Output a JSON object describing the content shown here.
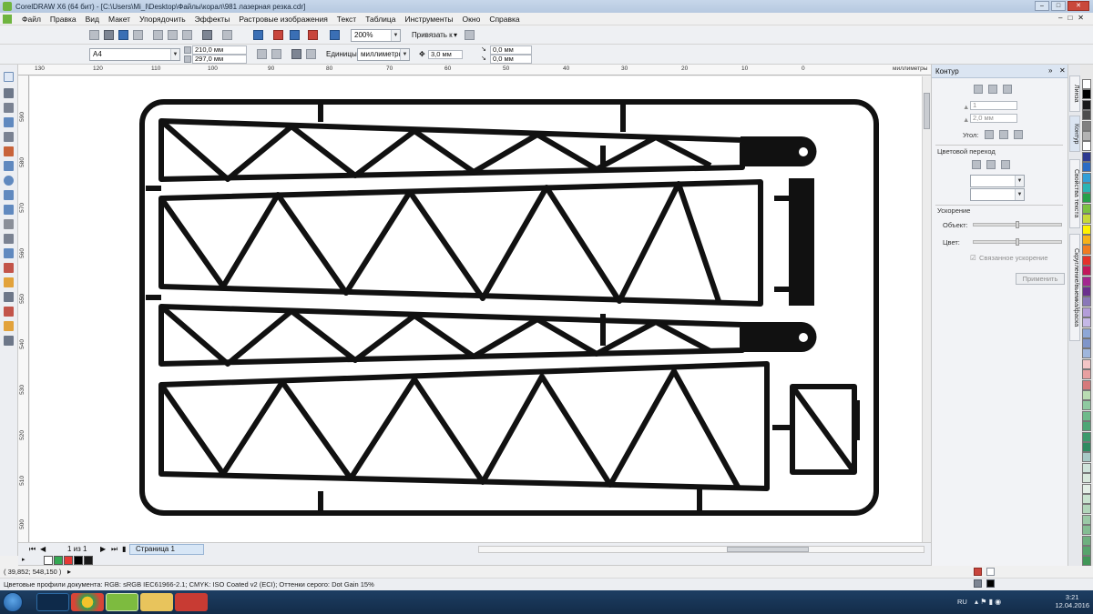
{
  "window": {
    "title": "CorelDRAW X6 (64 бит) - [C:\\Users\\Mi_I\\Desktop\\Файлы\\корал\\981 лазерная резка.cdr]"
  },
  "menu": [
    "Файл",
    "Правка",
    "Вид",
    "Макет",
    "Упорядочить",
    "Эффекты",
    "Растровые изображения",
    "Текст",
    "Таблица",
    "Инструменты",
    "Окно",
    "Справка"
  ],
  "toolbar": {
    "zoom": "200%",
    "snap_label": "Привязать к"
  },
  "propbar": {
    "page_size": "A4",
    "width": "210,0 мм",
    "height": "297,0 мм",
    "units_label": "Единицы:",
    "units_value": "миллиметры",
    "nudge": "3,0 мм",
    "dup_x": "0,0 мм",
    "dup_y": "0,0 мм"
  },
  "rulers": {
    "h_ticks": [
      "130",
      "120",
      "110",
      "100",
      "90",
      "80",
      "70",
      "60",
      "50",
      "40",
      "30",
      "20",
      "10",
      "0"
    ],
    "h_unit": "миллиметры",
    "v_ticks": [
      "590",
      "580",
      "570",
      "560",
      "550",
      "540",
      "530",
      "520",
      "510",
      "500"
    ]
  },
  "pagenav": {
    "counter": "1 из 1",
    "page_tab": "Страница 1"
  },
  "status": {
    "coords": "( 39,852; 548,150 )",
    "profiles": "Цветовые профили документа: RGB: sRGB IEC61966-2.1; CMYK: ISO Coated v2 (ECI); Оттенки серого: Dot Gain 15%"
  },
  "docker": {
    "title": "Контур",
    "field_count": "1",
    "field_width": "2,0 мм",
    "angle_label": "Угол:",
    "blend_section": "Цветовой переход",
    "accel_section": "Ускорение",
    "object_label": "Объект:",
    "color_label": "Цвет:",
    "linked_accel": "Связанное ускорение",
    "apply_button": "Применить"
  },
  "side_tabs": [
    "Линза",
    "Контур",
    "Свойства текста",
    "Скругление/выемка/фаска"
  ],
  "palette_colors": [
    "#ffffff",
    "#000000",
    "#1a1a1a",
    "#4d4d4d",
    "#808080",
    "#b3b3b3",
    "#ffffff",
    "#2f3a8f",
    "#2b6cc4",
    "#33a0d8",
    "#2bb4b4",
    "#27a04a",
    "#7cc242",
    "#c8d93a",
    "#fff200",
    "#f6b21a",
    "#f07c22",
    "#e4322b",
    "#c2185b",
    "#a3278f",
    "#6b2f8e",
    "#8a78b8",
    "#b39dd8",
    "#c5b8e6",
    "#8ea7d6",
    "#7f95c9",
    "#9fb6dc",
    "#f3c5c5",
    "#e8a0a0",
    "#d67a7a",
    "#b9dcb2",
    "#8fcaa0",
    "#6fba8a",
    "#4fa675",
    "#3d9a6c",
    "#2f8b60",
    "#a7c9c5",
    "#cfe3da",
    "#d9e8dc",
    "#e4efe6",
    "#c9e3cf",
    "#b2d6ba",
    "#9bc9a6",
    "#84bd92",
    "#6eb07e",
    "#57a46b",
    "#419757"
  ],
  "document_colors": [
    "#ffffff",
    "#34a853",
    "#e53935",
    "#000000",
    "#1a1a1a"
  ],
  "taskbar": {
    "lang": "RU",
    "time": "3:21",
    "date": "12.04.2016"
  }
}
